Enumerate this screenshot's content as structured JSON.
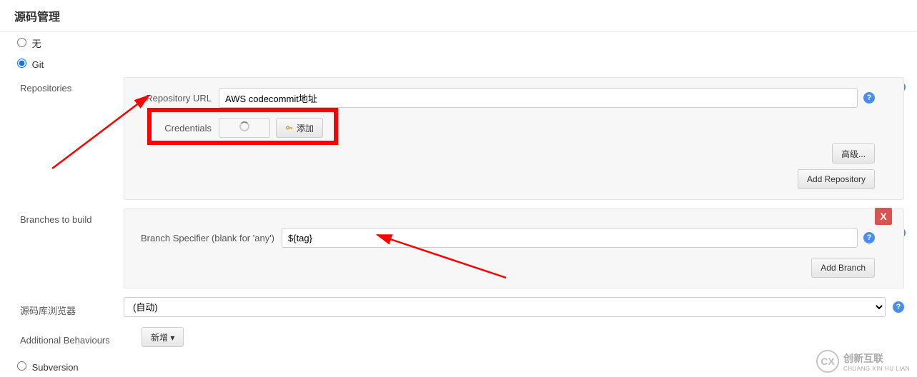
{
  "section": {
    "title": "源码管理"
  },
  "scm": {
    "none_label": "无",
    "git_label": "Git",
    "subversion_label": "Subversion",
    "selected": "git"
  },
  "repositories": {
    "label": "Repositories",
    "url_label": "Repository URL",
    "url_value": "AWS codecommit地址",
    "credentials_label": "Credentials",
    "add_label": "添加",
    "advanced_label": "高级...",
    "add_repo_label": "Add Repository"
  },
  "branches": {
    "label": "Branches to build",
    "specifier_label": "Branch Specifier (blank for 'any')",
    "specifier_value": "${tag}",
    "close_label": "X",
    "add_branch_label": "Add Branch"
  },
  "browser": {
    "label": "源码库浏览器",
    "value": "(自动)"
  },
  "behaviours": {
    "label": "Additional Behaviours",
    "add_label": "新增 ▾"
  },
  "help_icon_text": "?",
  "watermark": {
    "logo_text": "CX",
    "name_cn": "创新互联",
    "name_en": "CHUANG XIN HU LIAN"
  }
}
